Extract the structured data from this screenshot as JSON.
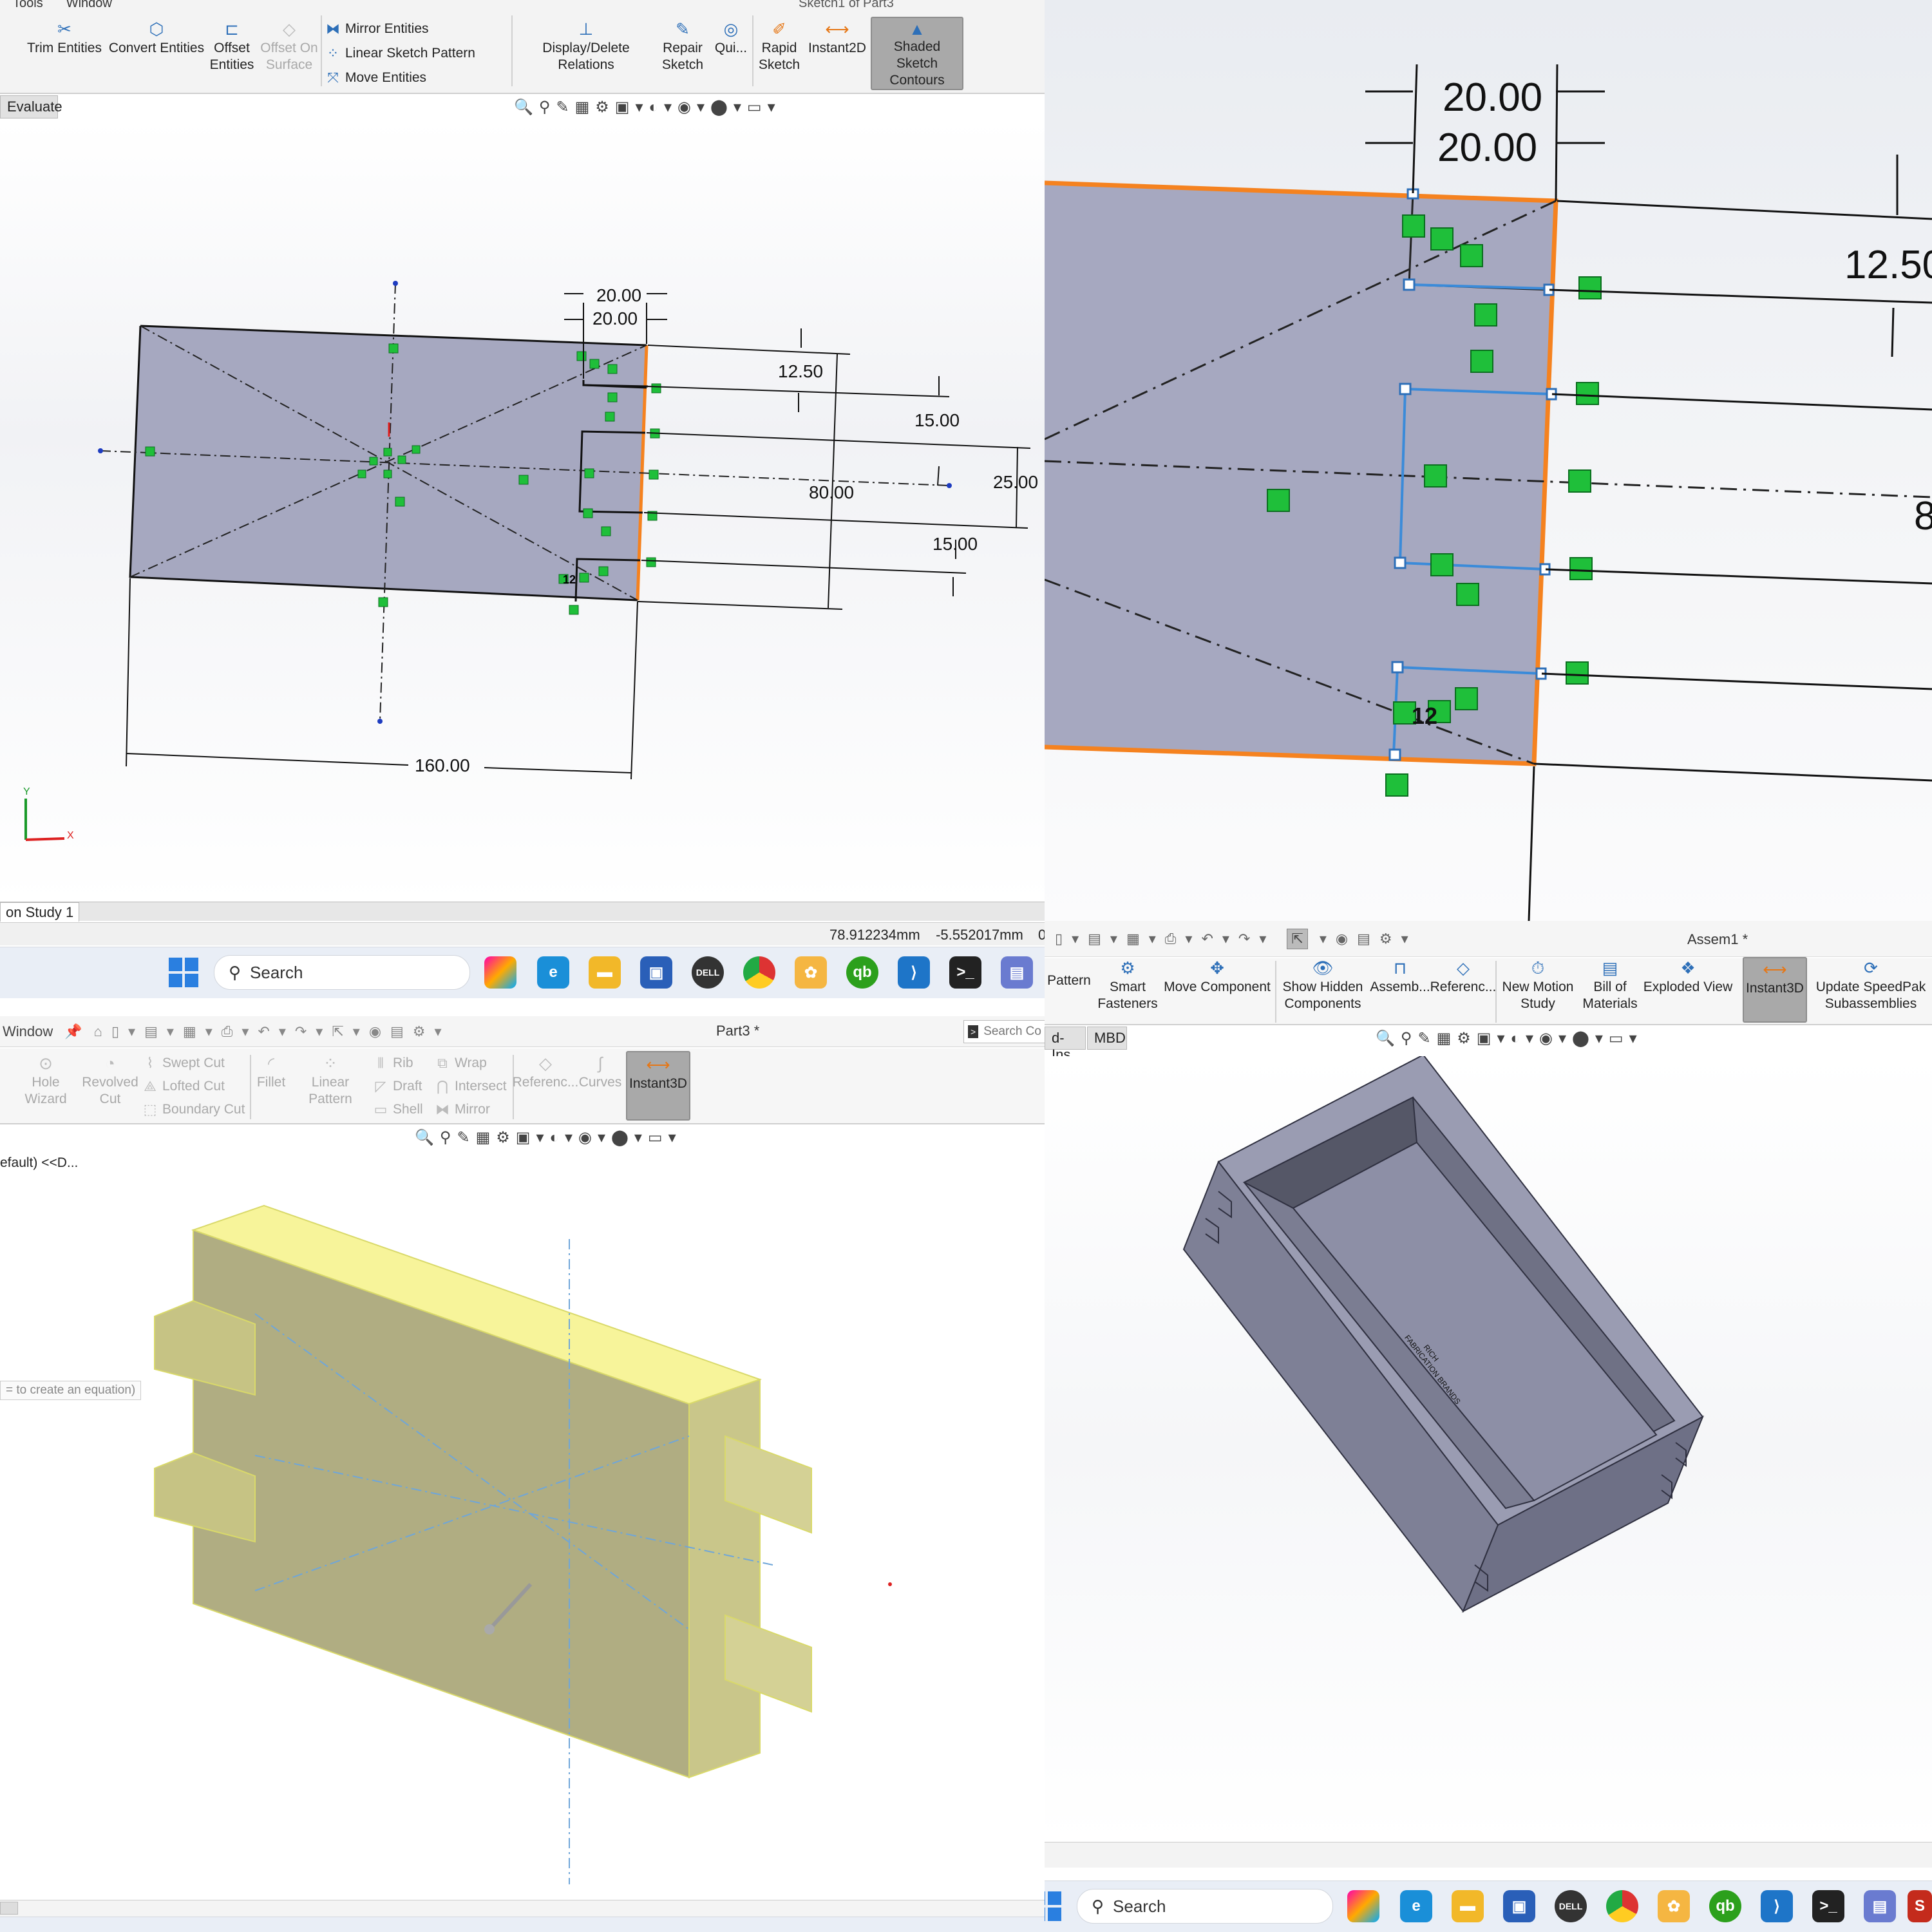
{
  "q1": {
    "menu": [
      "Tools",
      "Window"
    ],
    "title_partial": "Sketch1 of Part3",
    "ribbon": {
      "trim": "Trim Entities",
      "convert": "Convert Entities",
      "offset": "Offset Entities",
      "offset_surface": "Offset On Surface",
      "mirror": "Mirror Entities",
      "linear_pattern": "Linear Sketch Pattern",
      "move": "Move Entities",
      "display_relations": "Display/Delete Relations",
      "repair": "Repair Sketch",
      "quick": "Qui...",
      "rapid": "Rapid Sketch",
      "instant2d": "Instant2D",
      "shaded": "Shaded Sketch Contours"
    },
    "tab_evaluate": "Evaluate",
    "dims": {
      "d20a": "20.00",
      "d20b": "20.00",
      "d12_5": "12.50",
      "d15a": "15.00",
      "d25": "25.00",
      "d80": "80.00",
      "d15b": "15.00",
      "d160": "160.00",
      "rel12": "12"
    },
    "axes": {
      "x": "X",
      "y": "Y"
    },
    "tab_study": "on Study 1",
    "coords": "78.912234mm    -5.552017mm",
    "coord_extra": "0"
  },
  "q2": {
    "dims": {
      "d20a": "20.00",
      "d20b": "20.00",
      "d12_5": "12.50",
      "d8": "8",
      "rel12": "12"
    }
  },
  "q3": {
    "taskbar_search": "Search",
    "menu": "Window",
    "doc_title": "Part3 *",
    "search_cmd": "Search Co",
    "ribbon": {
      "hole": "Hole Wizard",
      "revolved": "Revolved Cut",
      "swept": "Swept Cut",
      "lofted": "Lofted Cut",
      "boundary": "Boundary Cut",
      "fillet": "Fillet",
      "linpat": "Linear Pattern",
      "rib": "Rib",
      "draft": "Draft",
      "shell": "Shell",
      "wrap": "Wrap",
      "intersect": "Intersect",
      "mirror": "Mirror",
      "reference": "Referenc...",
      "curves": "Curves",
      "instant3d": "Instant3D"
    },
    "tree_item": "efault) <<D...",
    "equation_hint": "= to create an equation)"
  },
  "q4": {
    "title": "Assem1 *",
    "ribbon": {
      "pattern": "Pattern",
      "smart": "Smart Fasteners",
      "move": "Move Component",
      "hidden": "Show Hidden Components",
      "assembly": "Assemb...",
      "reference": "Referenc...",
      "motion": "New Motion Study",
      "bom": "Bill of Materials",
      "exploded": "Exploded View",
      "instant3d": "Instant3D",
      "speedpak": "Update SpeedPak Subassemblies"
    },
    "tabs": [
      "d-Ins",
      "MBD"
    ],
    "taskbar_search": "Search",
    "engraving": [
      "RICH",
      "FABRICATION BRANDS"
    ]
  },
  "colors": {
    "sketch_fill": "#a6a8c0",
    "orange": "#f5821f",
    "green": "#1fbf3a",
    "relation_blue": "#3b8bd9",
    "highlight_yellow": "#f7f49a",
    "box_face": "#8d8fa6",
    "accent_blue": "#2d6fb8"
  }
}
